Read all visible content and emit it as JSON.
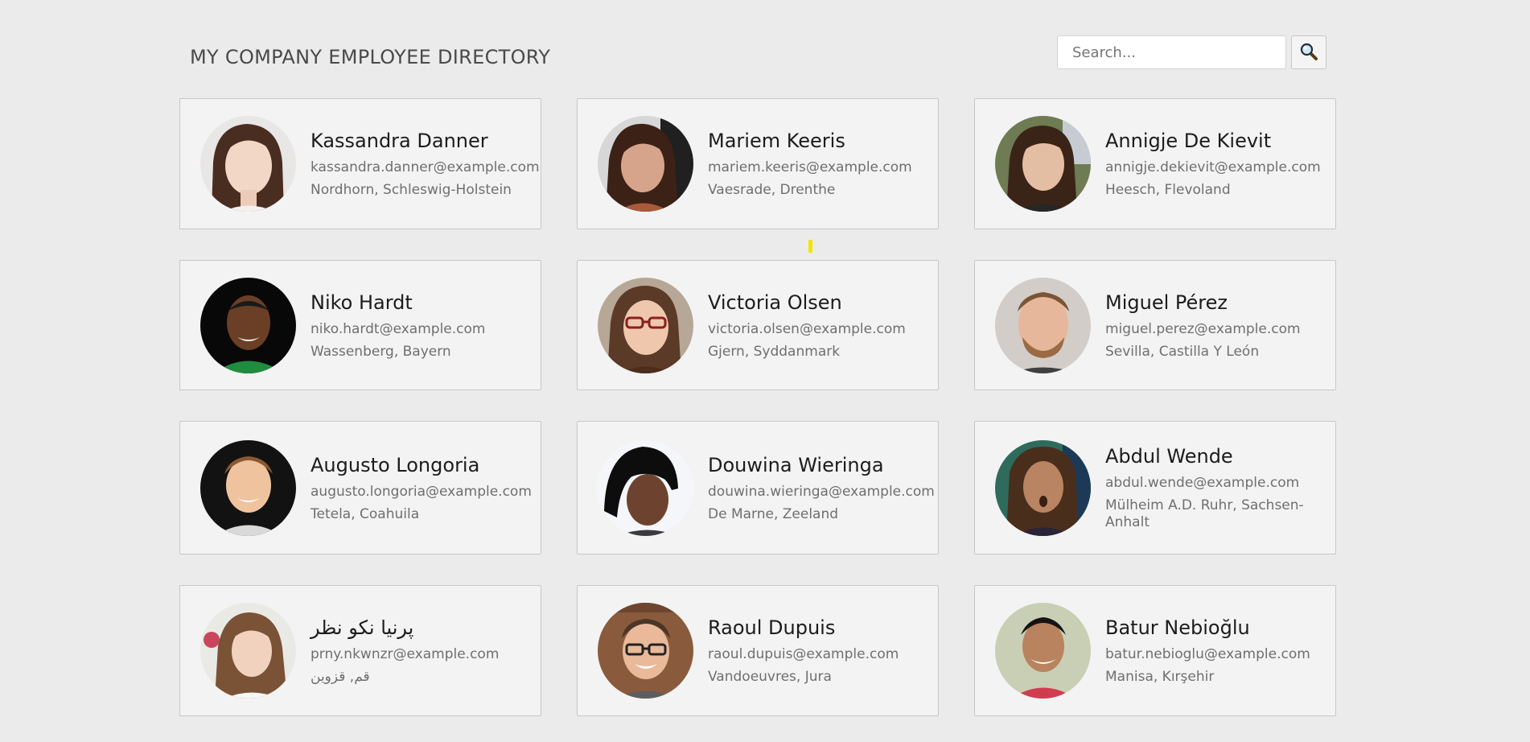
{
  "header": {
    "title": "MY COMPANY EMPLOYEE DIRECTORY"
  },
  "search": {
    "placeholder": "Search...",
    "value": "",
    "button_icon": "magnifier-icon"
  },
  "colors": {
    "page_background": "#ebebeb",
    "card_background": "#f3f3f3",
    "card_border": "#c7c7c7",
    "name_text": "#1c1c1c",
    "detail_text": "#6f6f6f",
    "marker": "#f2e600"
  },
  "employees": [
    {
      "name": "Kassandra Danner",
      "email": "kassandra.danner@example.com",
      "location": "Nordhorn, Schleswig-Holstein"
    },
    {
      "name": "Mariem Keeris",
      "email": "mariem.keeris@example.com",
      "location": "Vaesrade, Drenthe"
    },
    {
      "name": "Annigje De Kievit",
      "email": "annigje.dekievit@example.com",
      "location": "Heesch, Flevoland"
    },
    {
      "name": "Niko Hardt",
      "email": "niko.hardt@example.com",
      "location": "Wassenberg, Bayern"
    },
    {
      "name": "Victoria Olsen",
      "email": "victoria.olsen@example.com",
      "location": "Gjern, Syddanmark"
    },
    {
      "name": "Miguel Pérez",
      "email": "miguel.perez@example.com",
      "location": "Sevilla, Castilla Y León"
    },
    {
      "name": "Augusto Longoria",
      "email": "augusto.longoria@example.com",
      "location": "Tetela, Coahuila"
    },
    {
      "name": "Douwina Wieringa",
      "email": "douwina.wieringa@example.com",
      "location": "De Marne, Zeeland"
    },
    {
      "name": "Abdul Wende",
      "email": "abdul.wende@example.com",
      "location": "Mülheim A.D. Ruhr, Sachsen-Anhalt"
    },
    {
      "name": "پرنیا نکو نظر",
      "email": "prny.nkwnzr@example.com",
      "location": "قم, قزوین"
    },
    {
      "name": "Raoul Dupuis",
      "email": "raoul.dupuis@example.com",
      "location": "Vandoeuvres, Jura"
    },
    {
      "name": "Batur Nebioğlu",
      "email": "batur.nebioglu@example.com",
      "location": "Manisa, Kırşehir"
    }
  ]
}
